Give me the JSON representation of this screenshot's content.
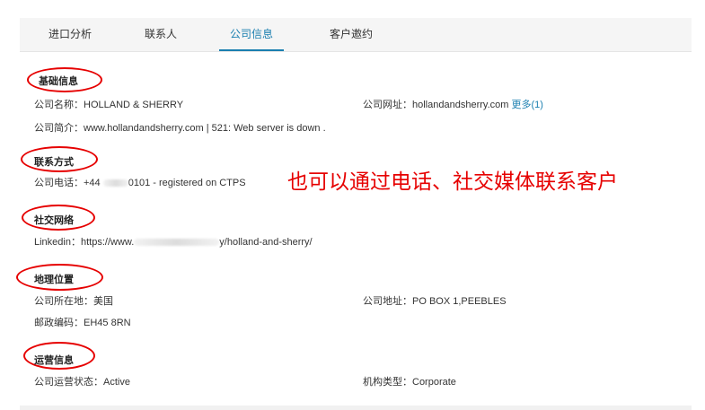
{
  "tabs": [
    {
      "label": "进口分析"
    },
    {
      "label": "联系人"
    },
    {
      "label": "公司信息",
      "active": true
    },
    {
      "label": "客户邀约"
    }
  ],
  "sections": {
    "basic": {
      "title": "基础信息",
      "company_name_label": "公司名称：",
      "company_name": "HOLLAND & SHERRY",
      "website_label": "公司网址：",
      "website": "hollandandsherry.com",
      "more_link": "更多(1)",
      "intro_label": "公司简介：",
      "intro": "www.hollandandsherry.com | 521: Web server is down ."
    },
    "contact": {
      "title": "联系方式",
      "phone_label": "公司电话：",
      "phone_prefix": "+44",
      "phone_suffix": "0101 - registered on CTPS"
    },
    "social": {
      "title": "社交网络",
      "linkedin_label": "Linkedin：",
      "linkedin_prefix": "https://www.",
      "linkedin_suffix": "y/holland-and-sherry/"
    },
    "geo": {
      "title": "地理位置",
      "location_label": "公司所在地：",
      "location": "美国",
      "address_label": "公司地址：",
      "address": "PO BOX 1,PEEBLES",
      "postcode_label": "邮政编码：",
      "postcode": "EH45 8RN"
    },
    "ops": {
      "title": "运营信息",
      "status_label": "公司运营状态：",
      "status": "Active",
      "org_type_label": "机构类型：",
      "org_type": "Corporate"
    }
  },
  "annotation": "也可以通过电话、社交媒体联系客户",
  "colors": {
    "accent": "#1a7fb0",
    "annotation_red": "#e60000"
  }
}
